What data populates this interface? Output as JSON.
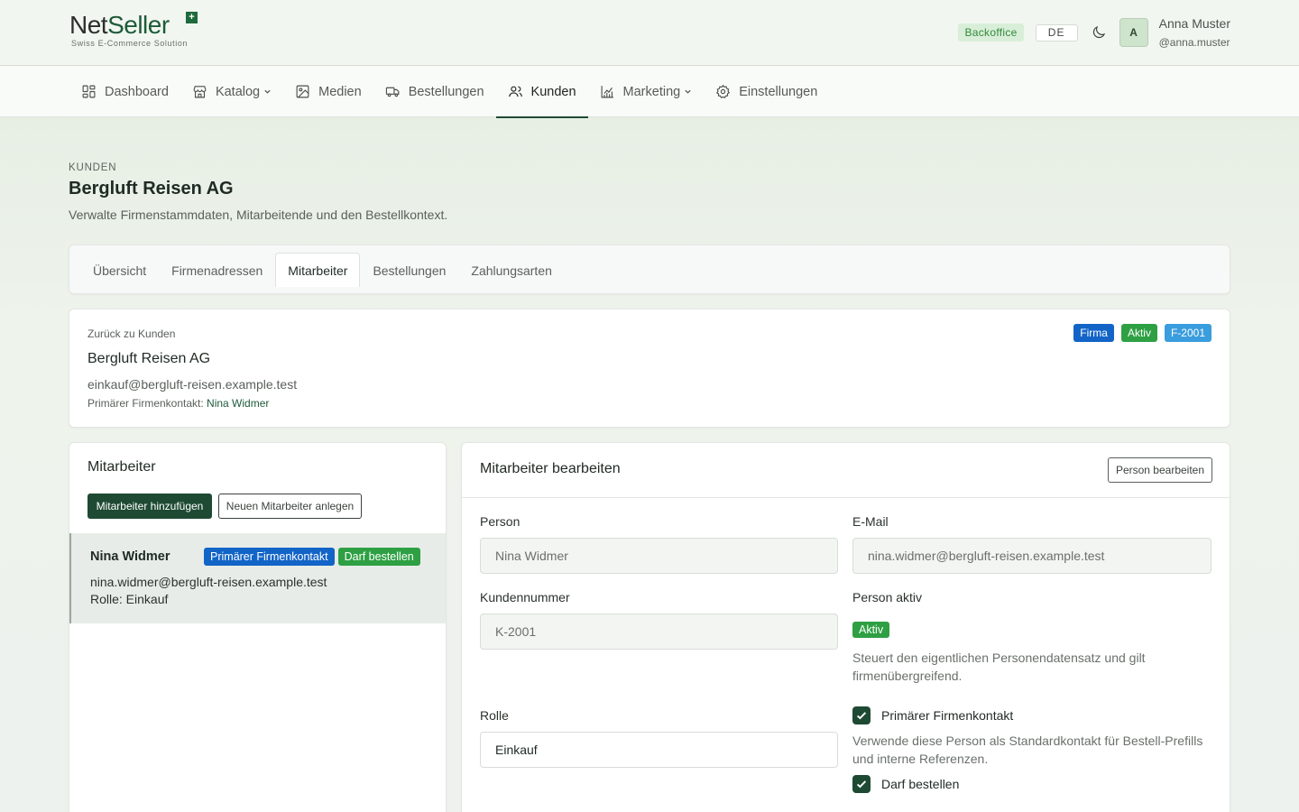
{
  "brand": {
    "name_part1": "Net",
    "name_part2": "Seller",
    "plus": "+",
    "tagline": "Swiss E-Commerce Solution"
  },
  "header": {
    "badge": "Backoffice",
    "language": "DE",
    "avatar_initial": "A",
    "user_name": "Anna Muster",
    "user_handle": "@anna.muster"
  },
  "nav": {
    "items": [
      {
        "label": "Dashboard",
        "icon": "dashboard-icon"
      },
      {
        "label": "Katalog",
        "icon": "store-icon",
        "dropdown": true
      },
      {
        "label": "Medien",
        "icon": "image-icon"
      },
      {
        "label": "Bestellungen",
        "icon": "truck-icon"
      },
      {
        "label": "Kunden",
        "icon": "users-icon",
        "active": true
      },
      {
        "label": "Marketing",
        "icon": "chart-icon",
        "dropdown": true
      },
      {
        "label": "Einstellungen",
        "icon": "gear-icon"
      }
    ]
  },
  "page": {
    "eyebrow": "KUNDEN",
    "title": "Bergluft Reisen AG",
    "description": "Verwalte Firmenstammdaten, Mitarbeitende und den Bestellkontext."
  },
  "tabs": [
    "Übersicht",
    "Firmenadressen",
    "Mitarbeiter",
    "Bestellungen",
    "Zahlungsarten"
  ],
  "company": {
    "back_link": "Zurück zu Kunden",
    "name": "Bergluft Reisen AG",
    "email": "einkauf@bergluft-reisen.example.test",
    "contact_label": "Primärer Firmenkontakt:",
    "contact_name": "Nina Widmer",
    "badges": [
      "Firma",
      "Aktiv",
      "F-2001"
    ]
  },
  "employees": {
    "title": "Mitarbeiter",
    "add_button": "Mitarbeiter hinzufügen",
    "create_button": "Neuen Mitarbeiter anlegen",
    "items": [
      {
        "name": "Nina Widmer",
        "badges": [
          "Primärer Firmenkontakt",
          "Darf bestellen"
        ],
        "email": "nina.widmer@bergluft-reisen.example.test",
        "role": "Rolle: Einkauf"
      }
    ]
  },
  "editor": {
    "title": "Mitarbeiter bearbeiten",
    "edit_person_button": "Person bearbeiten",
    "person_label": "Person",
    "person_value": "Nina Widmer",
    "email_label": "E-Mail",
    "email_value": "nina.widmer@bergluft-reisen.example.test",
    "customer_number_label": "Kundennummer",
    "customer_number_value": "K-2001",
    "person_active_label": "Person aktiv",
    "person_active_badge": "Aktiv",
    "person_active_help": "Steuert den eigentlichen Personendatensatz und gilt firmenübergreifend.",
    "role_label": "Rolle",
    "role_value": "Einkauf",
    "primary_contact_label": "Primärer Firmenkontakt",
    "primary_contact_checked": true,
    "primary_contact_help": "Verwende diese Person als Standardkontakt für Bestell-Prefills und interne Referenzen.",
    "may_order_label": "Darf bestellen",
    "may_order_checked": true
  }
}
